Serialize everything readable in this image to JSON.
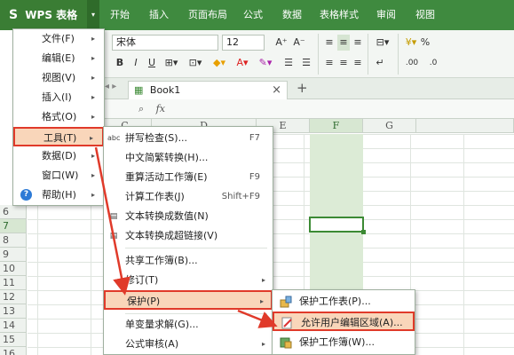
{
  "app": {
    "logo": "S",
    "name": "WPS 表格",
    "menu_arrow": "▾"
  },
  "menubar": {
    "tabs": [
      "开始",
      "插入",
      "页面布局",
      "公式",
      "数据",
      "表格样式",
      "审阅",
      "视图"
    ]
  },
  "ribbon": {
    "font_name": "宋体",
    "font_size": "12",
    "grow_font": "A⁺",
    "shrink_font": "A⁻",
    "bold": "B",
    "italic": "I",
    "underline": "U",
    "percent": "%",
    "decimal_add": ".00",
    "decimal_remove": ".0"
  },
  "tabs": {
    "book_name": "Book1",
    "close": "×",
    "new": "+"
  },
  "formula_bar": {
    "fx": "fx"
  },
  "columns": [
    "B",
    "C",
    "D",
    "E",
    "F",
    "G"
  ],
  "rows": [
    "6",
    "7",
    "8",
    "9",
    "10",
    "11",
    "12",
    "13",
    "14",
    "15",
    "16"
  ],
  "main_menu": {
    "items": [
      {
        "label": "文件(F)",
        "arrow": "▸"
      },
      {
        "label": "编辑(E)",
        "arrow": "▸"
      },
      {
        "label": "视图(V)",
        "arrow": "▸"
      },
      {
        "label": "插入(I)",
        "arrow": "▸"
      },
      {
        "label": "格式(O)",
        "arrow": "▸"
      },
      {
        "label": "工具(T)",
        "arrow": "▸"
      },
      {
        "label": "数据(D)",
        "arrow": "▸"
      },
      {
        "label": "窗口(W)",
        "arrow": "▸"
      },
      {
        "label": "帮助(H)",
        "arrow": "▸"
      }
    ],
    "help_icon_glyph": "?"
  },
  "tools_menu": {
    "items": [
      {
        "label": "拼写检查(S)...",
        "shortcut": "F7",
        "icon": "abc"
      },
      {
        "label": "中文简繁转换(H)..."
      },
      {
        "label": "重算活动工作簿(E)",
        "shortcut": "F9"
      },
      {
        "label": "计算工作表(J)",
        "shortcut": "Shift+F9"
      },
      {
        "label": "文本转换成数值(N)"
      },
      {
        "label": "文本转换成超链接(V)"
      },
      {
        "label": "共享工作簿(B)..."
      },
      {
        "label": "修订(T)",
        "arrow": "▸"
      },
      {
        "label": "保护(P)",
        "arrow": "▸"
      },
      {
        "label": "单变量求解(G)..."
      },
      {
        "label": "公式审核(A)",
        "arrow": "▸"
      }
    ]
  },
  "protect_menu": {
    "items": [
      {
        "label": "保护工作表(P)..."
      },
      {
        "label": "允许用户编辑区域(A)..."
      },
      {
        "label": "保护工作簿(W)..."
      }
    ]
  },
  "colors": {
    "highlight_border": "#e03a2a",
    "highlight_fill": "#f9d6ba",
    "brand_green": "#3f8a3f"
  }
}
